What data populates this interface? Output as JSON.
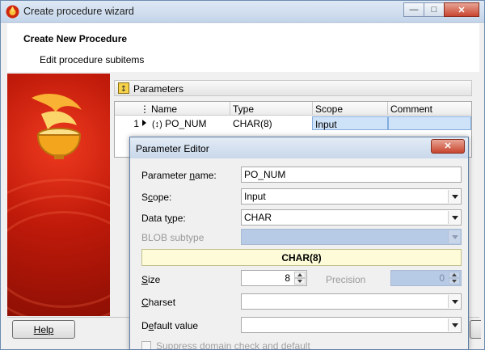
{
  "window": {
    "title": "Create procedure wizard",
    "header_title": "Create New Procedure",
    "header_subtitle": "Edit procedure subitems"
  },
  "parameters_panel": {
    "label": "Parameters",
    "columns": [
      "Name",
      "Type",
      "Scope",
      "Comment"
    ],
    "rows": [
      {
        "num": "1",
        "name": "PO_NUM",
        "type": "CHAR(8)",
        "scope": "Input",
        "comment": ""
      }
    ]
  },
  "footer": {
    "help_label": "Help"
  },
  "editor": {
    "title": "Parameter Editor",
    "name_label_pre": "Parameter ",
    "name_label_key": "n",
    "name_label_post": "ame:",
    "name_value": "PO_NUM",
    "scope_label_pre": "S",
    "scope_label_key": "c",
    "scope_label_post": "ope:",
    "scope_value": "Input",
    "datatype_label_pre": "Data t",
    "datatype_label_key": "y",
    "datatype_label_post": "pe:",
    "datatype_value": "CHAR",
    "blob_label": "BLOB subtype",
    "blob_value": "",
    "type_banner": "CHAR(8)",
    "size_label_key": "S",
    "size_label_post": "ize",
    "size_value": "8",
    "precision_label": "Precision",
    "precision_value": "0",
    "charset_label_key": "C",
    "charset_label_post": "harset",
    "charset_value": "",
    "default_label_pre": "D",
    "default_label_key": "e",
    "default_label_post": "fault value",
    "default_value": "",
    "suppress_label": "Suppress domain check and default"
  },
  "colors": {
    "selection": "#cfe3f8",
    "disabled_field": "#b8cbe6",
    "banner": "#fdfbd8",
    "logo_red": "#c01a0a"
  }
}
